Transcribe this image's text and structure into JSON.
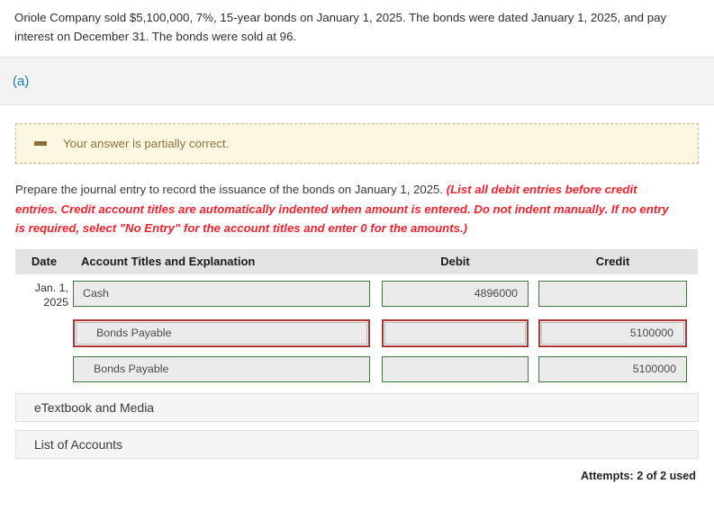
{
  "problem": {
    "statement": "Oriole Company sold $5,100,000, 7%, 15-year bonds on January 1, 2025. The bonds were dated January 1, 2025, and pay interest on December 31. The bonds were sold at 96."
  },
  "part": {
    "label": "(a)"
  },
  "alert": {
    "icon": "minus-icon",
    "message": "Your answer is partially correct.",
    "border_color": "#cdb77e",
    "background_color": "#fdf6e0",
    "text_color": "#8a7441"
  },
  "instructions": {
    "lead": "Prepare the journal entry to record the issuance of the bonds on January 1, 2025.",
    "emphasis": "(List all debit entries before credit entries. Credit account titles are automatically indented when amount is entered. Do not indent manually. If no entry is required, select \"No Entry\" for the account titles and enter 0 for the amounts.)",
    "emphasis_color": "#f4212e"
  },
  "journal": {
    "headers": {
      "date": "Date",
      "account": "Account Titles and Explanation",
      "debit": "Debit",
      "credit": "Credit"
    },
    "rows": [
      {
        "date_line1": "Jan. 1,",
        "date_line2": "2025",
        "account": "Cash",
        "account_indent": false,
        "account_state": "correct",
        "debit": "4896000",
        "debit_state": "correct",
        "credit": "",
        "credit_state": "correct"
      },
      {
        "date_line1": "",
        "date_line2": "",
        "account": "Bonds Payable",
        "account_indent": true,
        "account_state": "error",
        "debit": "",
        "debit_state": "error",
        "credit": "5100000",
        "credit_state": "error"
      },
      {
        "date_line1": "",
        "date_line2": "",
        "account": "Bonds Payable",
        "account_indent": true,
        "account_state": "correct",
        "debit": "",
        "debit_state": "correct",
        "credit": "5100000",
        "credit_state": "correct"
      }
    ],
    "correct_border_color": "#3c7a3c",
    "error_border_color": "#b03636"
  },
  "panels": [
    {
      "label": "eTextbook and Media"
    },
    {
      "label": "List of Accounts"
    }
  ],
  "footer": {
    "attempts": "Attempts: 2 of 2 used"
  }
}
